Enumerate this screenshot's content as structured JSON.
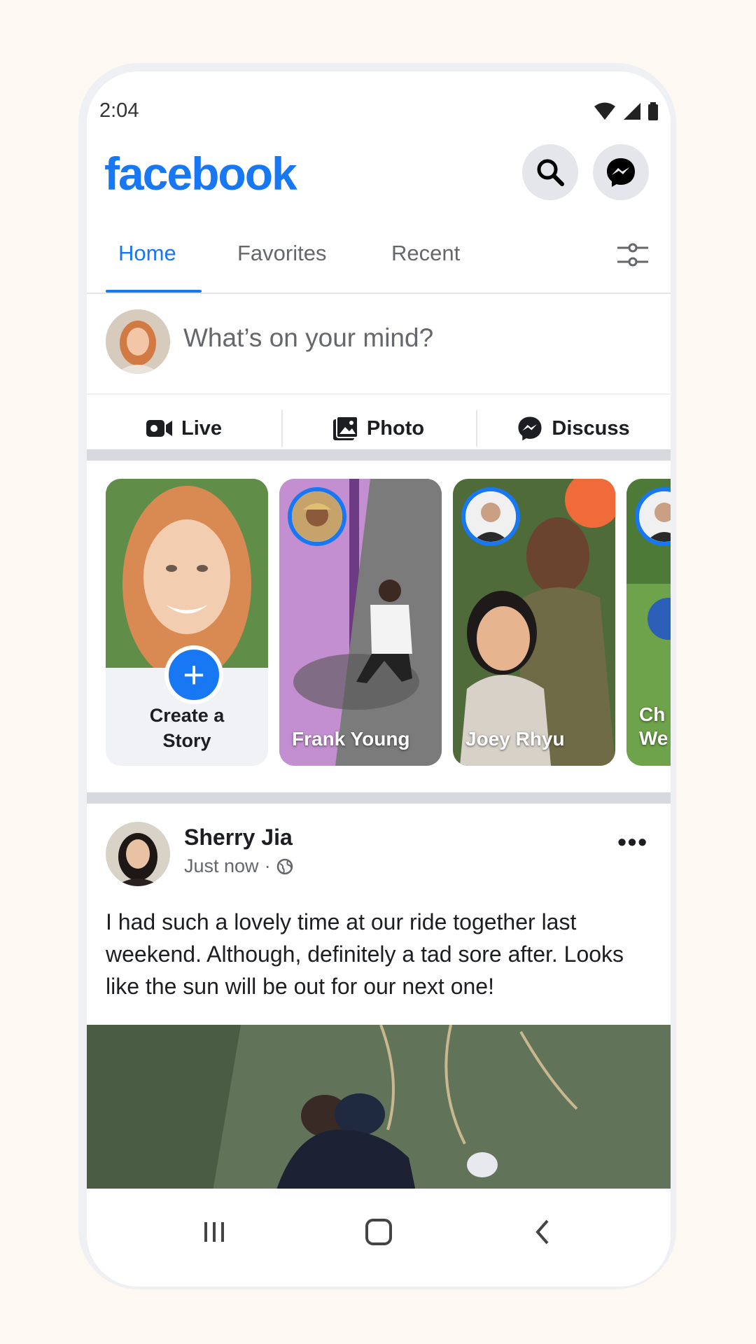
{
  "status": {
    "time": "2:04"
  },
  "app": {
    "logo": "facebook",
    "accent": "#1877f2"
  },
  "header": {
    "search_icon": "search-icon",
    "messenger_icon": "messenger-icon"
  },
  "tabs": [
    {
      "label": "Home",
      "active": true
    },
    {
      "label": "Favorites",
      "active": false
    },
    {
      "label": "Recent",
      "active": false
    }
  ],
  "composer": {
    "placeholder": "What’s on your mind?"
  },
  "actions": [
    {
      "label": "Live",
      "icon": "video-camera-icon"
    },
    {
      "label": "Photo",
      "icon": "photo-icon"
    },
    {
      "label": "Discuss",
      "icon": "messenger-icon"
    }
  ],
  "stories": {
    "create": {
      "line1": "Create a",
      "line2": "Story"
    },
    "items": [
      {
        "name": "Frank Young"
      },
      {
        "name": "Joey Rhyu"
      },
      {
        "name": "Ch We"
      }
    ]
  },
  "post": {
    "author": "Sherry Jia",
    "time": "Just now",
    "separator": "·",
    "privacy_icon": "globe-icon",
    "more_label": "•••",
    "text": "I had such a lovely time at our ride together last weekend. Although, definitely a tad sore after. Looks like the sun will be out for our next one!"
  },
  "navbar": {
    "recent_icon": "recent-apps-icon",
    "home_icon": "home-button-icon",
    "back_icon": "back-icon"
  }
}
